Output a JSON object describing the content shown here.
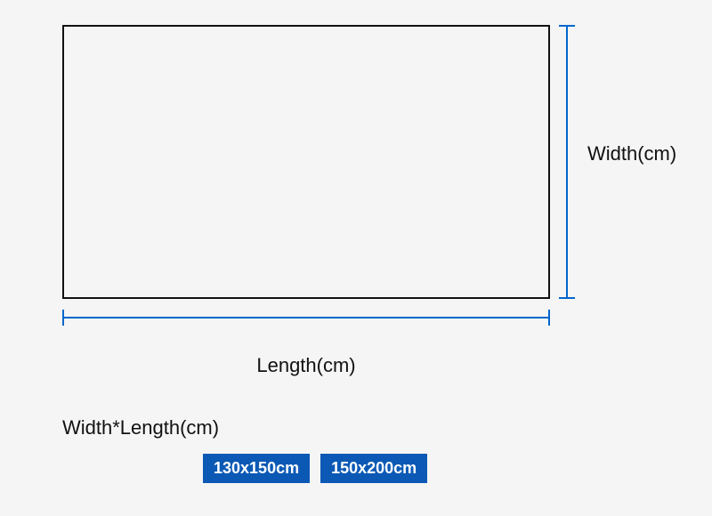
{
  "labels": {
    "width": "Width(cm)",
    "length": "Length(cm)",
    "formula": "Width*Length(cm)"
  },
  "sizes": [
    "130x150cm",
    "150x200cm"
  ],
  "colors": {
    "accent": "#0b59b5",
    "dimension": "#0066cc"
  }
}
